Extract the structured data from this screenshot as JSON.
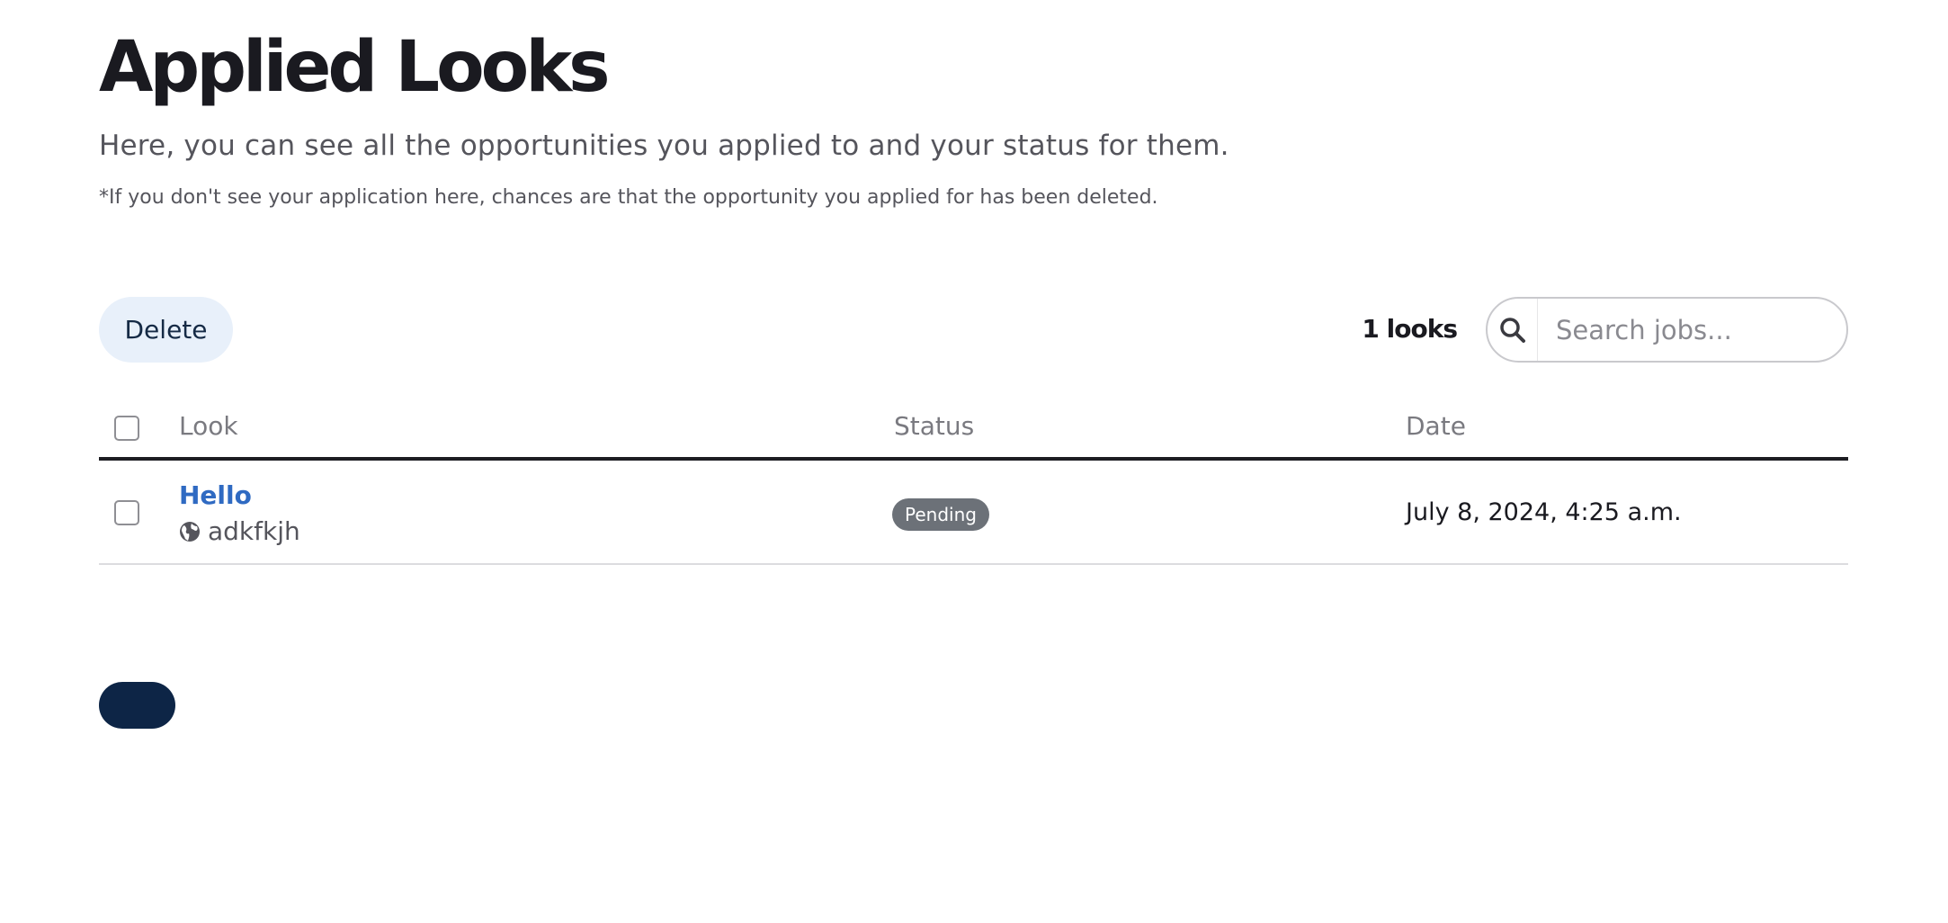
{
  "page": {
    "title": "Applied Looks",
    "subtitle": "Here, you can see all the opportunities you applied to and your status for them.",
    "note": "*If you don't see your application here, chances are that the opportunity you applied for has been deleted."
  },
  "toolbar": {
    "delete_label": "Delete",
    "count_label": "1 looks",
    "search_placeholder": "Search jobs...",
    "search_value": "",
    "search_icon": "search-icon"
  },
  "table": {
    "columns": [
      "Look",
      "Status",
      "Date"
    ],
    "rows": [
      {
        "look": "Hello",
        "location": "adkfkjh",
        "location_icon": "globe-icon",
        "status": "Pending",
        "date": "July 8, 2024, 4:25 a.m.",
        "checked": false
      }
    ]
  },
  "colors": {
    "title": "#1a1a20",
    "link": "#2f6ac2",
    "badge_bg": "#6c7178",
    "delete_bg": "#e8f0fa",
    "pager_bg": "#0d2546"
  }
}
